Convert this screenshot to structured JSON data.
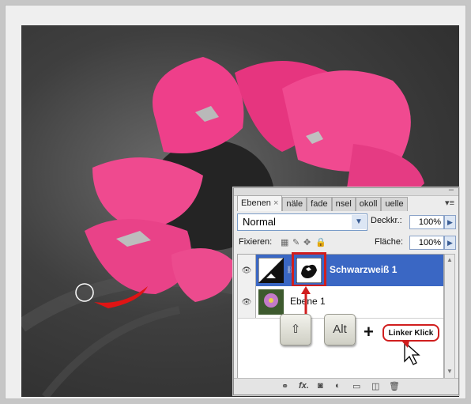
{
  "panel": {
    "tabs": [
      {
        "label": "Ebenen",
        "close": "×"
      },
      {
        "label": "näle"
      },
      {
        "label": "fade"
      },
      {
        "label": "nsel"
      },
      {
        "label": "okoll"
      },
      {
        "label": "uelle"
      }
    ],
    "minimize": "–",
    "menu": "▾≡",
    "blend_mode": "Normal",
    "opacity_label": "Deckkr.:",
    "opacity_value": "100%",
    "lock_label": "Fixieren:",
    "fill_label": "Fläche:",
    "fill_value": "100%",
    "layers": [
      {
        "name": "Schwarzweiß 1"
      },
      {
        "name": "Ebene 1"
      }
    ]
  },
  "keys": {
    "shift": "⇧",
    "alt": "Alt",
    "plus": "+",
    "click_label": "Linker Klick"
  },
  "colors": {
    "selected_layer": "#3a67c4",
    "highlight": "#d01e1e",
    "petal": "#ee3f8a"
  }
}
